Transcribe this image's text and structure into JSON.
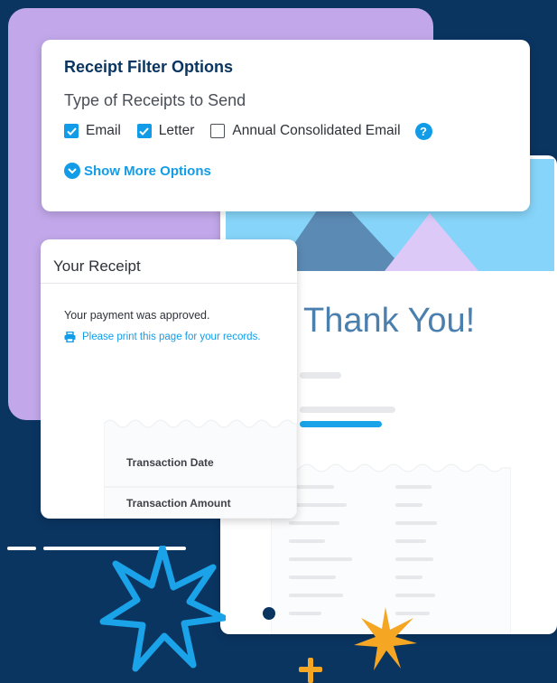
{
  "filter_card": {
    "title": "Receipt Filter Options",
    "subtitle": "Type of Receipts to Send",
    "options": [
      {
        "label": "Email",
        "checked": true
      },
      {
        "label": "Letter",
        "checked": true
      },
      {
        "label": "Annual Consolidated Email",
        "checked": false
      }
    ],
    "help_icon": "?",
    "show_more_label": "Show More Options"
  },
  "thanks_card": {
    "heading": "Thank You!"
  },
  "receipt_card": {
    "title": "Your Receipt",
    "approved_text": "Your payment was approved.",
    "print_text": "Please print this page for your records.",
    "transaction_date_label": "Transaction Date",
    "transaction_amount_label": "Transaction Amount"
  },
  "colors": {
    "background": "#0a3561",
    "purple": "#c2a8ea",
    "accent_blue": "#129ce8",
    "sky": "#86d4f9",
    "sun": "#fcd576",
    "star_orange": "#f5a623",
    "star_blue": "#1aa3e8"
  },
  "icons": [
    "check-icon",
    "help-icon",
    "chevron-down-icon",
    "printer-icon",
    "mountain-sun-illustration",
    "star-icon",
    "sparkle-icon",
    "plus-icon"
  ]
}
